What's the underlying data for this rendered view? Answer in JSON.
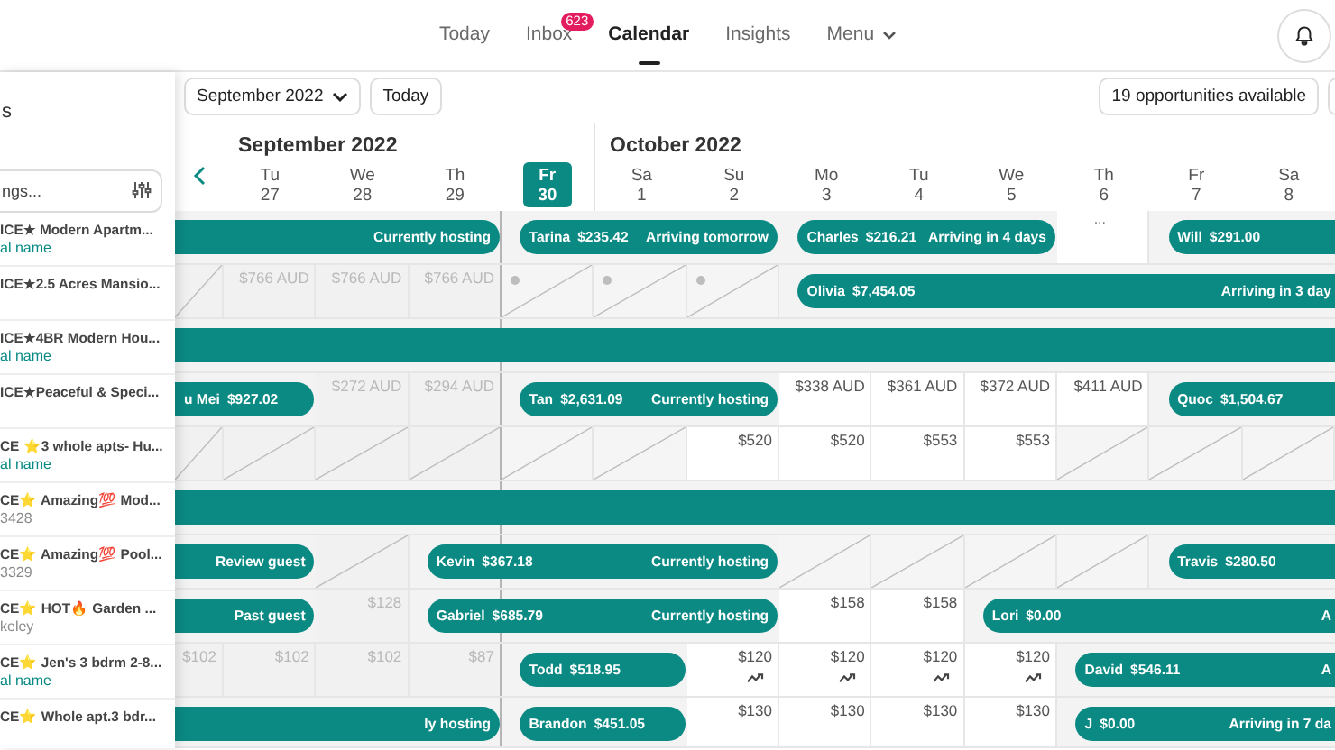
{
  "nav": {
    "tabs": [
      {
        "label": "Today",
        "selected": false
      },
      {
        "label": "Inbox",
        "selected": false,
        "badge": "623"
      },
      {
        "label": "Calendar",
        "selected": true
      },
      {
        "label": "Insights",
        "selected": false
      },
      {
        "label": "Menu",
        "selected": false,
        "kind": "dropdown"
      }
    ]
  },
  "sidebar": {
    "heading": "s",
    "search": {
      "placeholder": "ngs..."
    },
    "listings": [
      {
        "kind": "link",
        "title": "ICE★ Modern Apartm...",
        "subtitle": "al name"
      },
      {
        "kind": "plain",
        "title": "ICE★2.5 Acres Mansio..."
      },
      {
        "kind": "link",
        "title": "ICE★4BR Modern Hou...",
        "subtitle": "al name"
      },
      {
        "kind": "plain",
        "title": "ICE★Peaceful & Speci..."
      },
      {
        "kind": "link",
        "title": "CE ⭐3 whole apts- Hu...",
        "subtitle": "al name"
      },
      {
        "kind": "text",
        "title": "CE⭐ Amazing💯 Mod...",
        "subtitle": "3428"
      },
      {
        "kind": "text",
        "title": "CE⭐ Amazing💯 Pool...",
        "subtitle": "3329"
      },
      {
        "kind": "text",
        "title": "CE⭐ HOT🔥 Garden ...",
        "subtitle": "keley"
      },
      {
        "kind": "link",
        "title": "CE⭐ Jen's 3 bdrm 2-8...",
        "subtitle": "al name"
      },
      {
        "kind": "plain",
        "title": "CE⭐ Whole apt.3 bdr..."
      }
    ]
  },
  "toolbar": {
    "month_select": "September 2022",
    "today_button": "Today",
    "opportunities_button": "19 opportunities available"
  },
  "timeline": {
    "months": [
      {
        "label": "September 2022",
        "days": [
          {
            "weekday": "Tu",
            "day": "27",
            "selected": false
          },
          {
            "weekday": "We",
            "day": "28",
            "selected": false
          },
          {
            "weekday": "Th",
            "day": "29",
            "selected": false
          },
          {
            "weekday": "Fr",
            "day": "30",
            "selected": true
          }
        ]
      },
      {
        "label": "October 2022",
        "days": [
          {
            "weekday": "Sa",
            "day": "1",
            "selected": false
          },
          {
            "weekday": "Su",
            "day": "2",
            "selected": false
          },
          {
            "weekday": "Mo",
            "day": "3",
            "selected": false
          },
          {
            "weekday": "Tu",
            "day": "4",
            "selected": false
          },
          {
            "weekday": "We",
            "day": "5",
            "selected": false
          },
          {
            "weekday": "Th",
            "day": "6",
            "selected": false
          },
          {
            "weekday": "Fr",
            "day": "7",
            "selected": false
          },
          {
            "weekday": "Sa",
            "day": "8",
            "selected": false
          }
        ]
      }
    ],
    "rows": [
      {
        "cells": [
          {
            "kind": "booked",
            "booking": {
              "status": "Currently hosting",
              "continued": true
            }
          },
          {
            "kind": "booked"
          },
          {
            "kind": "booked"
          },
          {
            "kind": "booked"
          },
          {
            "kind": "booked",
            "booking": {
              "guest": "Tarina",
              "amount": "$235.42",
              "status": "Arriving tomorrow",
              "continued": false
            }
          },
          {
            "kind": "booked"
          },
          {
            "kind": "booked"
          },
          {
            "kind": "booked",
            "booking": {
              "guest": "Charles",
              "amount": "$216.21",
              "status": "Arriving in 4 days",
              "continued": false
            }
          },
          {
            "kind": "booked"
          },
          {
            "kind": "booked"
          },
          {
            "kind": "more",
            "text": "..."
          },
          {
            "kind": "booked",
            "booking": {
              "guest": "Will",
              "amount": "$291.00",
              "continued": false
            }
          },
          {
            "kind": "booked"
          }
        ]
      },
      {
        "cells": [
          {
            "kind": "blocked"
          },
          {
            "kind": "price",
            "price": "$766 AUD"
          },
          {
            "kind": "price",
            "price": "$766 AUD"
          },
          {
            "kind": "price",
            "price": "$766 AUD"
          },
          {
            "kind": "dot"
          },
          {
            "kind": "dot"
          },
          {
            "kind": "dot"
          },
          {
            "kind": "booked",
            "booking": {
              "guest": "Olivia",
              "amount": "$7,454.05",
              "status": "Arriving in 3 day",
              "continued": false
            }
          },
          {
            "kind": "booked"
          },
          {
            "kind": "booked"
          },
          {
            "kind": "booked"
          },
          {
            "kind": "booked"
          },
          {
            "kind": "booked"
          }
        ]
      },
      {
        "cells": [
          {
            "kind": "booked",
            "booking": {
              "continued": true
            }
          },
          {
            "kind": "booked"
          },
          {
            "kind": "booked"
          },
          {
            "kind": "booked"
          },
          {
            "kind": "booked"
          },
          {
            "kind": "booked"
          },
          {
            "kind": "booked"
          },
          {
            "kind": "booked"
          },
          {
            "kind": "booked"
          },
          {
            "kind": "booked"
          },
          {
            "kind": "booked"
          },
          {
            "kind": "booked"
          },
          {
            "kind": "booked"
          }
        ]
      },
      {
        "cells": [
          {
            "kind": "booked",
            "booking": {
              "guest": "u Mei",
              "amount": "$927.02",
              "continued": true
            }
          },
          {
            "kind": "booked"
          },
          {
            "kind": "price",
            "price": "$272 AUD"
          },
          {
            "kind": "price",
            "price": "$294 AUD"
          },
          {
            "kind": "booked",
            "booking": {
              "guest": "Tan",
              "amount": "$2,631.09",
              "status": "Currently hosting",
              "continued": false
            }
          },
          {
            "kind": "booked"
          },
          {
            "kind": "booked"
          },
          {
            "kind": "price",
            "price": "$338 AUD"
          },
          {
            "kind": "price",
            "price": "$361 AUD"
          },
          {
            "kind": "price",
            "price": "$372 AUD"
          },
          {
            "kind": "price",
            "price": "$411 AUD"
          },
          {
            "kind": "booked",
            "booking": {
              "guest": "Quoc",
              "amount": "$1,504.67",
              "continued": false
            }
          },
          {
            "kind": "booked"
          }
        ]
      },
      {
        "cells": [
          {
            "kind": "blocked"
          },
          {
            "kind": "blocked"
          },
          {
            "kind": "blocked"
          },
          {
            "kind": "blocked"
          },
          {
            "kind": "blocked"
          },
          {
            "kind": "blocked"
          },
          {
            "kind": "price",
            "price": "$520"
          },
          {
            "kind": "price",
            "price": "$520"
          },
          {
            "kind": "price",
            "price": "$553"
          },
          {
            "kind": "price",
            "price": "$553"
          },
          {
            "kind": "blocked"
          },
          {
            "kind": "blocked"
          },
          {
            "kind": "blocked"
          }
        ]
      },
      {
        "cells": [
          {
            "kind": "booked",
            "booking": {
              "continued": true
            }
          },
          {
            "kind": "booked"
          },
          {
            "kind": "booked"
          },
          {
            "kind": "booked"
          },
          {
            "kind": "booked"
          },
          {
            "kind": "booked"
          },
          {
            "kind": "booked"
          },
          {
            "kind": "booked"
          },
          {
            "kind": "booked"
          },
          {
            "kind": "booked"
          },
          {
            "kind": "booked"
          },
          {
            "kind": "booked"
          },
          {
            "kind": "booked"
          }
        ]
      },
      {
        "cells": [
          {
            "kind": "booked",
            "booking": {
              "status": "Review guest",
              "continued": true
            }
          },
          {
            "kind": "booked"
          },
          {
            "kind": "blocked"
          },
          {
            "kind": "booked",
            "booking": {
              "guest": "Kevin",
              "amount": "$367.18",
              "status": "Currently hosting",
              "continued": false
            }
          },
          {
            "kind": "booked"
          },
          {
            "kind": "booked"
          },
          {
            "kind": "booked"
          },
          {
            "kind": "blocked"
          },
          {
            "kind": "blocked"
          },
          {
            "kind": "blocked"
          },
          {
            "kind": "blocked"
          },
          {
            "kind": "booked",
            "booking": {
              "guest": "Travis",
              "amount": "$280.50",
              "continued": false
            }
          },
          {
            "kind": "booked"
          }
        ]
      },
      {
        "cells": [
          {
            "kind": "booked",
            "booking": {
              "status": "Past guest",
              "continued": true
            }
          },
          {
            "kind": "booked"
          },
          {
            "kind": "price",
            "price": "$128"
          },
          {
            "kind": "booked",
            "booking": {
              "guest": "Gabriel",
              "amount": "$685.79",
              "status": "Currently hosting",
              "continued": false
            }
          },
          {
            "kind": "booked"
          },
          {
            "kind": "booked"
          },
          {
            "kind": "booked"
          },
          {
            "kind": "price",
            "price": "$158"
          },
          {
            "kind": "price",
            "price": "$158"
          },
          {
            "kind": "booked",
            "booking": {
              "guest": "Lori",
              "amount": "$0.00",
              "status": "A",
              "continued": false
            }
          },
          {
            "kind": "booked"
          },
          {
            "kind": "booked"
          },
          {
            "kind": "booked"
          }
        ]
      },
      {
        "cells": [
          {
            "kind": "price",
            "price": "$102"
          },
          {
            "kind": "price",
            "price": "$102"
          },
          {
            "kind": "price",
            "price": "$102"
          },
          {
            "kind": "price",
            "price": "$87"
          },
          {
            "kind": "booked",
            "booking": {
              "guest": "Todd",
              "amount": "$518.95",
              "continued": false
            }
          },
          {
            "kind": "booked"
          },
          {
            "kind": "price",
            "price": "$120",
            "trend": true
          },
          {
            "kind": "price",
            "price": "$120",
            "trend": true
          },
          {
            "kind": "price",
            "price": "$120",
            "trend": true
          },
          {
            "kind": "price",
            "price": "$120",
            "trend": true
          },
          {
            "kind": "booked",
            "booking": {
              "guest": "David",
              "amount": "$546.11",
              "status": "A",
              "continued": false
            }
          },
          {
            "kind": "booked"
          },
          {
            "kind": "booked"
          }
        ]
      },
      {
        "cells": [
          {
            "kind": "booked",
            "booking": {
              "status": "ly hosting",
              "continued": true
            }
          },
          {
            "kind": "booked"
          },
          {
            "kind": "booked"
          },
          {
            "kind": "booked"
          },
          {
            "kind": "booked",
            "booking": {
              "guest": "Brandon",
              "amount": "$451.05",
              "continued": false
            }
          },
          {
            "kind": "booked"
          },
          {
            "kind": "price",
            "price": "$130"
          },
          {
            "kind": "price",
            "price": "$130"
          },
          {
            "kind": "price",
            "price": "$130"
          },
          {
            "kind": "price",
            "price": "$130"
          },
          {
            "kind": "booked",
            "booking": {
              "guest": "J",
              "amount": "$0.00",
              "status": "Arriving in 7 da",
              "continued": false
            }
          },
          {
            "kind": "booked"
          },
          {
            "kind": "booked"
          }
        ]
      }
    ]
  }
}
